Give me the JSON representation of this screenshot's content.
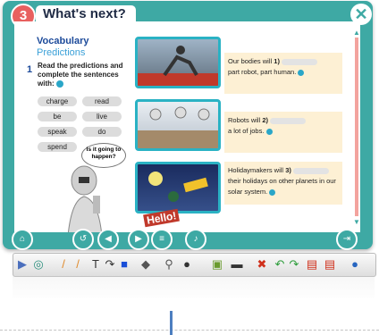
{
  "header": {
    "badge": "3",
    "title": "What's next?",
    "close_icon": "close-icon"
  },
  "content": {
    "heading": "Vocabulary",
    "subheading": "Predictions",
    "step_number": "1",
    "instruction": "Read the predictions and complete the sentences with:",
    "word_bank": [
      "charge",
      "read",
      "be",
      "live",
      "speak",
      "do",
      "spend"
    ],
    "thought_bubble": "Is it going to happen?",
    "sentences": [
      {
        "before": "Our bodies will",
        "num": "1)",
        "after": "part robot, part human."
      },
      {
        "before": "Robots will",
        "num": "2)",
        "after": "a lot of jobs."
      },
      {
        "before": "Holidaymakers will",
        "num": "3)",
        "after": "their holidays on other planets in our solar system."
      }
    ],
    "hello_label": "Hello!"
  },
  "nav": [
    "home-icon",
    "back-icon",
    "prev-icon",
    "next-icon",
    "list-icon",
    "audio-icon",
    "exit-icon"
  ],
  "toolbar": [
    "expand-icon",
    "lasso-icon",
    "pen-icon",
    "marker-icon",
    "text-icon",
    "curve-icon",
    "square-icon",
    "eraser-icon",
    "zoom-icon",
    "spotlight-icon",
    "page-icon",
    "line-icon",
    "delete-icon",
    "undo-icon",
    "redo-icon",
    "save-icon",
    "print-icon",
    "globe-icon"
  ]
}
